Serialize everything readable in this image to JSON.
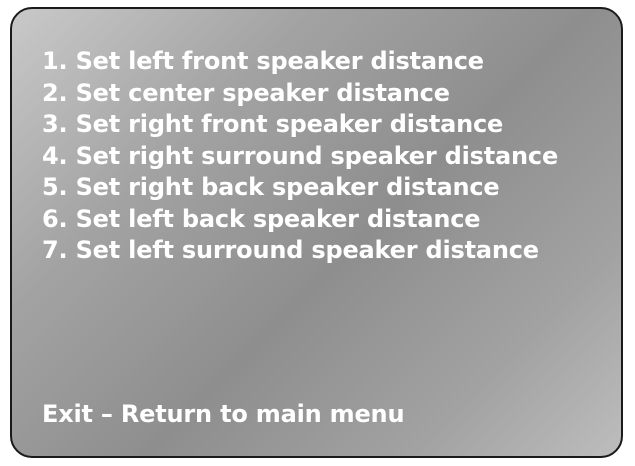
{
  "menu": {
    "items": [
      {
        "label": "1. Set left front speaker distance"
      },
      {
        "label": "2. Set center speaker distance"
      },
      {
        "label": "3. Set right front speaker distance"
      },
      {
        "label": "4. Set right surround speaker distance"
      },
      {
        "label": "5. Set right back speaker distance"
      },
      {
        "label": "6. Set left back speaker distance"
      },
      {
        "label": "7. Set left surround speaker distance"
      }
    ],
    "exit_label": "Exit – Return to main menu"
  },
  "colors": {
    "text": "#ffffff",
    "border": "#1a1a1a",
    "background": "#a3a3a3"
  }
}
